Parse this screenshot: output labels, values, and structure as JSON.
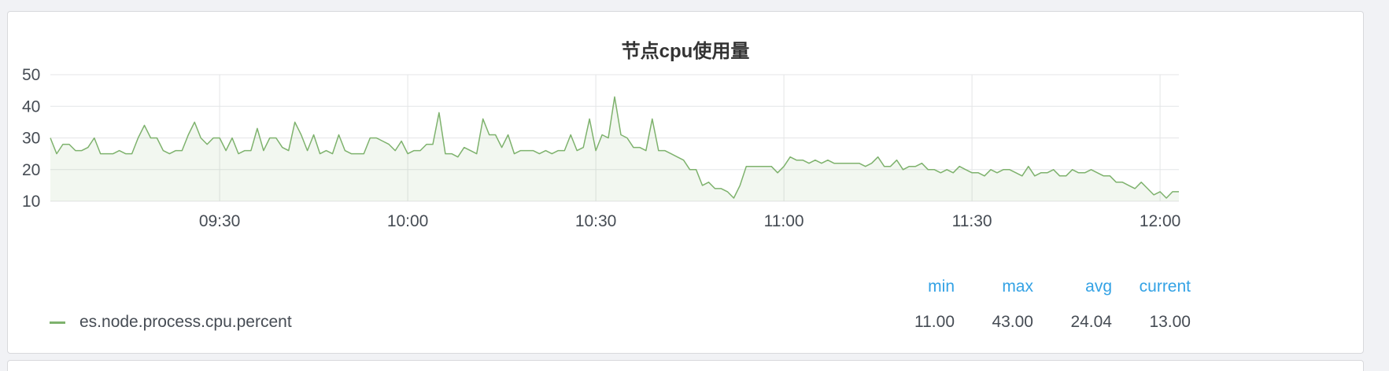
{
  "panel": {
    "title": "节点cpu使用量"
  },
  "chart_data": {
    "type": "area",
    "title": "节点cpu使用量",
    "xlabel": "",
    "ylabel": "",
    "ylim": [
      10,
      50
    ],
    "yticks": [
      "10",
      "20",
      "30",
      "40",
      "50"
    ],
    "xlim": [
      "09:03",
      "12:03"
    ],
    "xticks": [
      "09:30",
      "10:00",
      "10:30",
      "11:00",
      "11:30",
      "12:00"
    ],
    "grid": true,
    "series_color": "#7eb26d",
    "series": [
      {
        "name": "es.node.process.cpu.percent",
        "x": [
          "09:03",
          "09:04",
          "09:05",
          "09:06",
          "09:07",
          "09:08",
          "09:09",
          "09:10",
          "09:11",
          "09:12",
          "09:13",
          "09:14",
          "09:15",
          "09:16",
          "09:17",
          "09:18",
          "09:19",
          "09:20",
          "09:21",
          "09:22",
          "09:23",
          "09:24",
          "09:25",
          "09:26",
          "09:27",
          "09:28",
          "09:29",
          "09:30",
          "09:31",
          "09:32",
          "09:33",
          "09:34",
          "09:35",
          "09:36",
          "09:37",
          "09:38",
          "09:39",
          "09:40",
          "09:41",
          "09:42",
          "09:43",
          "09:44",
          "09:45",
          "09:46",
          "09:47",
          "09:48",
          "09:49",
          "09:50",
          "09:51",
          "09:52",
          "09:53",
          "09:54",
          "09:55",
          "09:56",
          "09:57",
          "09:58",
          "09:59",
          "10:00",
          "10:01",
          "10:02",
          "10:03",
          "10:04",
          "10:05",
          "10:06",
          "10:07",
          "10:08",
          "10:09",
          "10:10",
          "10:11",
          "10:12",
          "10:13",
          "10:14",
          "10:15",
          "10:16",
          "10:17",
          "10:18",
          "10:19",
          "10:20",
          "10:21",
          "10:22",
          "10:23",
          "10:24",
          "10:25",
          "10:26",
          "10:27",
          "10:28",
          "10:29",
          "10:30",
          "10:31",
          "10:32",
          "10:33",
          "10:34",
          "10:35",
          "10:36",
          "10:37",
          "10:38",
          "10:39",
          "10:40",
          "10:41",
          "10:42",
          "10:43",
          "10:44",
          "10:45",
          "10:46",
          "10:47",
          "10:48",
          "10:49",
          "10:50",
          "10:51",
          "10:52",
          "10:53",
          "10:54",
          "10:55",
          "10:56",
          "10:57",
          "10:58",
          "10:59",
          "11:00",
          "11:01",
          "11:02",
          "11:03",
          "11:04",
          "11:05",
          "11:06",
          "11:07",
          "11:08",
          "11:09",
          "11:10",
          "11:11",
          "11:12",
          "11:13",
          "11:14",
          "11:15",
          "11:16",
          "11:17",
          "11:18",
          "11:19",
          "11:20",
          "11:21",
          "11:22",
          "11:23",
          "11:24",
          "11:25",
          "11:26",
          "11:27",
          "11:28",
          "11:29",
          "11:30",
          "11:31",
          "11:32",
          "11:33",
          "11:34",
          "11:35",
          "11:36",
          "11:37",
          "11:38",
          "11:39",
          "11:40",
          "11:41",
          "11:42",
          "11:43",
          "11:44",
          "11:45",
          "11:46",
          "11:47",
          "11:48",
          "11:49",
          "11:50",
          "11:51",
          "11:52",
          "11:53",
          "11:54",
          "11:55",
          "11:56",
          "11:57",
          "11:58",
          "11:59",
          "12:00",
          "12:01",
          "12:02",
          "12:03"
        ],
        "values": [
          30,
          25,
          28,
          28,
          26,
          26,
          27,
          30,
          25,
          25,
          25,
          26,
          25,
          25,
          30,
          34,
          30,
          30,
          26,
          25,
          26,
          26,
          31,
          35,
          30,
          28,
          30,
          30,
          26,
          30,
          25,
          26,
          26,
          33,
          26,
          30,
          30,
          27,
          26,
          35,
          31,
          26,
          31,
          25,
          26,
          25,
          31,
          26,
          25,
          25,
          25,
          30,
          30,
          29,
          28,
          26,
          29,
          25,
          26,
          26,
          28,
          28,
          38,
          25,
          25,
          24,
          27,
          26,
          25,
          36,
          31,
          31,
          27,
          31,
          25,
          26,
          26,
          26,
          25,
          26,
          25,
          26,
          26,
          31,
          26,
          27,
          36,
          26,
          31,
          30,
          43,
          31,
          30,
          27,
          27,
          26,
          36,
          26,
          26,
          25,
          24,
          23,
          20,
          20,
          15,
          16,
          14,
          14,
          13,
          11,
          15,
          21,
          21,
          21,
          21,
          21,
          19,
          21,
          24,
          23,
          23,
          22,
          23,
          22,
          23,
          22,
          22,
          22,
          22,
          22,
          21,
          22,
          24,
          21,
          21,
          23,
          20,
          21,
          21,
          22,
          20,
          20,
          19,
          20,
          19,
          21,
          20,
          19,
          19,
          18,
          20,
          19,
          20,
          20,
          19,
          18,
          21,
          18,
          19,
          19,
          20,
          18,
          18,
          20,
          19,
          19,
          20,
          19,
          18,
          18,
          16,
          16,
          15,
          14,
          16,
          14,
          12,
          13,
          11,
          13,
          13
        ]
      }
    ]
  },
  "legend": {
    "headers": {
      "min": "min",
      "max": "max",
      "avg": "avg",
      "current": "current"
    },
    "series_name": "es.node.process.cpu.percent",
    "stats": {
      "min": "11.00",
      "max": "43.00",
      "avg": "24.04",
      "current": "13.00"
    }
  }
}
